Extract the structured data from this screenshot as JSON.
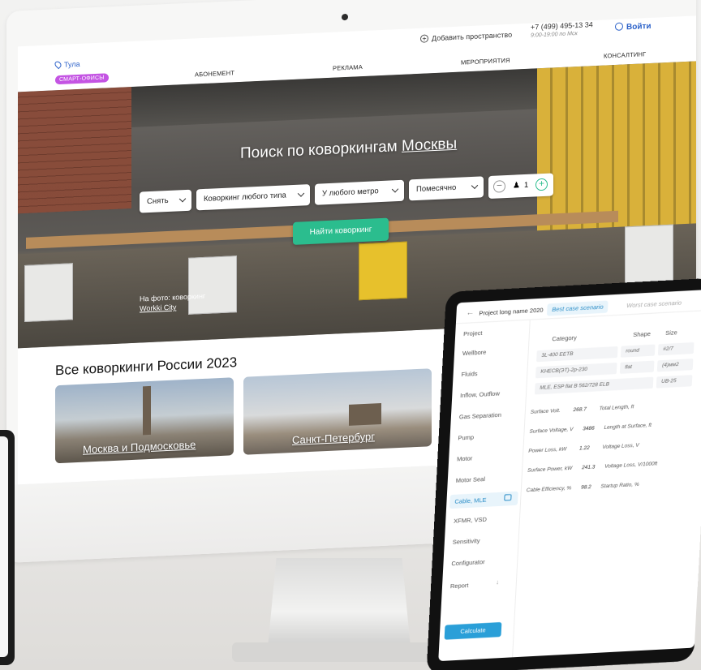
{
  "website": {
    "city": "Тула",
    "add_space": "Добавить пространство",
    "phone": "+7 (499) 495-13 34",
    "hours": "9:00-19:00 по Мск",
    "login": "Войти",
    "nav": {
      "smart_offices": "СМАРТ-ОФИСЫ",
      "subscription": "АБОНЕМЕНТ",
      "advertising": "РЕКЛАМА",
      "events": "МЕРОПРИЯТИЯ",
      "consulting": "КОНСАЛТИНГ"
    },
    "hero": {
      "title_prefix": "Поиск по коворкингам",
      "title_city": "Москвы",
      "filters": {
        "deal": "Снять",
        "type": "Коворкинг любого типа",
        "metro": "У любого метро",
        "period": "Помесячно",
        "guests": "1"
      },
      "find_button": "Найти коворкинг",
      "photo_caption_line1": "На фото: коворкинг",
      "photo_caption_link": "Workki City"
    },
    "section_title": "Все коворкинги России 2023",
    "cards": [
      {
        "label": "Москва и Подмосковье"
      },
      {
        "label": "Санкт-Петербург"
      }
    ]
  },
  "tablet_app": {
    "project_name": "Project long name 2020",
    "tabs": [
      "Best case scenario",
      "Worst case scenario"
    ],
    "sidebar": [
      "Project",
      "Wellbore",
      "Fluids",
      "Inflow, Outflow",
      "Gas Separation",
      "Pump",
      "Motor",
      "Motor Seal",
      "Cable, MLE",
      "XFMR, VSD",
      "Sensitivity",
      "Configurator",
      "Report"
    ],
    "active_item": "Cable, MLE",
    "calculate_button": "Calculate",
    "table_headers": {
      "category": "Category",
      "shape": "Shape",
      "size": "Size"
    },
    "table_rows": [
      {
        "category": "3L-400 EETB",
        "shape": "round",
        "size": "#2/7"
      },
      {
        "category": "KHECB(ЭТ)-2р-230",
        "shape": "flat",
        "size": "(4)мм2"
      },
      {
        "category": "MLE, ESP flat B 562/728 ELB",
        "shape": "",
        "size": "UB-25"
      }
    ],
    "metrics": [
      {
        "label": "Surface Volt.",
        "value": "268.7",
        "label2": "Total Length, ft"
      },
      {
        "label": "Surface Voltage, V",
        "value": "3486",
        "label2": "Length at Surface, ft"
      },
      {
        "label": "Power Loss, kW",
        "value": "1.22",
        "label2": "Voltage Loss, V"
      },
      {
        "label": "Surface Power, kW",
        "value": "241.3",
        "label2": "Voltage Loss, V/1000ft"
      },
      {
        "label": "Cable Efficiency, %",
        "value": "98.2",
        "label2": "Startup Ratio, %"
      }
    ]
  }
}
